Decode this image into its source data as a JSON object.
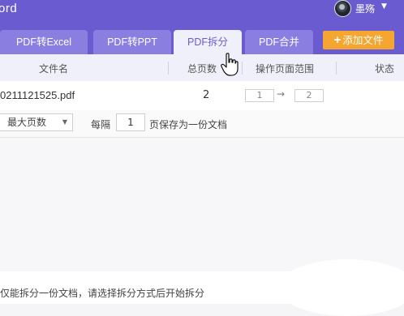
{
  "app": {
    "title_fragment": "ord"
  },
  "user": {
    "name": "墨殇",
    "caret": "▼"
  },
  "tabs": [
    {
      "label": "PDF转Excel"
    },
    {
      "label": "PDF转PPT"
    },
    {
      "label": "PDF拆分",
      "active": true
    },
    {
      "label": "PDF合并"
    }
  ],
  "add_file": {
    "icon": "plus",
    "label": "添加文件"
  },
  "columns": {
    "filename": "文件名",
    "total_pages": "总页数",
    "page_range": "操作页面范围",
    "status": "状态"
  },
  "row": {
    "filename": "0211121525.pdf",
    "total_pages": "2",
    "range_from": "1",
    "range_to": "2",
    "arrow": "→"
  },
  "options": {
    "split_mode": "最大页数",
    "every_label": "每隔",
    "every_value": "1",
    "every_suffix": "页保存为一份文档"
  },
  "footer": {
    "hint": "仅能拆分一份文档，请选择拆分方式后开始拆分"
  },
  "colors": {
    "header_purple": "#6a5cd0",
    "tab_inactive": "#8a7fe0",
    "accent_orange": "#f5a630"
  }
}
